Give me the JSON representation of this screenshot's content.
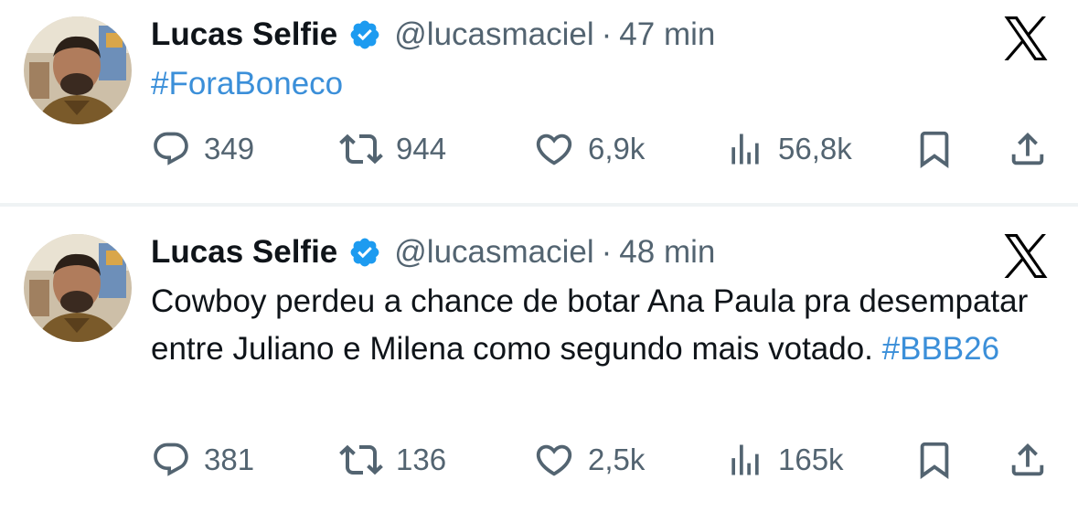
{
  "tweets": [
    {
      "author": {
        "display_name": "Lucas Selfie",
        "handle": "@lucasmaciel",
        "verified": true
      },
      "separator": "·",
      "time": "47 min",
      "text": "",
      "hashtag": "#ForaBoneco",
      "stats": {
        "replies": "349",
        "reposts": "944",
        "likes": "6,9k",
        "views": "56,8k"
      },
      "icons": [
        "reply-icon",
        "repost-icon",
        "like-icon",
        "views-icon",
        "bookmark-icon",
        "share-icon",
        "x-logo-icon",
        "verified-badge-icon"
      ]
    },
    {
      "author": {
        "display_name": "Lucas Selfie",
        "handle": "@lucasmaciel",
        "verified": true
      },
      "separator": "·",
      "time": "48 min",
      "text": "Cowboy perdeu a chance de botar Ana Paula pra desempatar entre Juliano e Milena como segundo mais votado. ",
      "hashtag": "#BBB26",
      "stats": {
        "replies": "381",
        "reposts": "136",
        "likes": "2,5k",
        "views": "165k"
      },
      "icons": [
        "reply-icon",
        "repost-icon",
        "like-icon",
        "views-icon",
        "bookmark-icon",
        "share-icon",
        "x-logo-icon",
        "verified-badge-icon"
      ]
    }
  ],
  "colors": {
    "text_primary": "#0f1419",
    "text_secondary": "#536471",
    "hashtag": "#3b8fd9",
    "verified_badge": "#1d9bf0",
    "separator": "#eff3f4"
  }
}
